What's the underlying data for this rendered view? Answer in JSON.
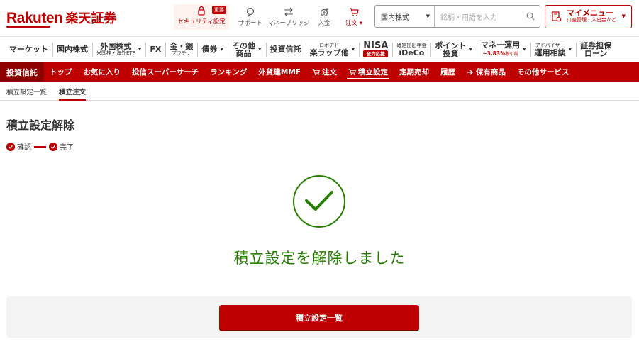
{
  "header": {
    "logo_en": "Rakuten",
    "logo_jp": "楽天証券",
    "icons": [
      {
        "icon": "lock-icon",
        "label": "セキュリティ設定",
        "badge": "重要"
      },
      {
        "icon": "support-chat-icon",
        "label": "サポート"
      },
      {
        "icon": "bank-transfer-icon",
        "label": "マネーブリッジ"
      },
      {
        "icon": "deposit-icon",
        "label": "入金"
      },
      {
        "icon": "cart-icon",
        "label": "注文 ▾"
      }
    ],
    "search": {
      "market": "国内株式",
      "placeholder": "銘柄・用語を入力"
    },
    "mymenu": {
      "title": "マイメニュー",
      "sub": "口座管理・入出金など"
    }
  },
  "category_nav": [
    {
      "label": "マーケット"
    },
    {
      "label": "国内株式"
    },
    {
      "label": "外国株式",
      "sub": "米国株・海外ETF",
      "dropdown": true
    },
    {
      "label": "FX"
    },
    {
      "label": "金・銀",
      "sub": "プラチナ"
    },
    {
      "label": "債券",
      "dropdown": true
    },
    {
      "label": "その他",
      "label2": "商品",
      "dropdown": true
    },
    {
      "label": "投資信託"
    },
    {
      "pre": "ロボアド",
      "label": "楽ラップ他",
      "dropdown": true
    },
    {
      "label": "NISA",
      "badge": "全力応援"
    },
    {
      "pre": "確定拠出年金",
      "label": "iDeCo"
    },
    {
      "label": "ポイント",
      "label2": "投資",
      "dropdown": true
    },
    {
      "label": "マネー運用",
      "red": "~3.83%",
      "red_small": "税引前",
      "dropdown": true
    },
    {
      "pre": "アドバイザー",
      "label": "運用相談",
      "dropdown": true
    },
    {
      "label": "証券担保",
      "label2": "ローン"
    }
  ],
  "fund_nav": {
    "brand": "投資信託",
    "items": [
      {
        "label": "トップ"
      },
      {
        "label": "お気に入り"
      },
      {
        "label": "投信スーパーサーチ"
      },
      {
        "label": "ランキング"
      },
      {
        "label": "外貨建MMF"
      },
      {
        "label": "注文",
        "icon": "cart-icon"
      },
      {
        "label": "積立設定",
        "icon": "cart-icon",
        "active": true
      },
      {
        "label": "定期売却"
      },
      {
        "label": "履歴"
      },
      {
        "label": "保有商品",
        "icon": "arrow-right-icon"
      },
      {
        "label": "その他サービス"
      }
    ]
  },
  "sub_nav": [
    {
      "label": "積立設定一覧"
    },
    {
      "label": "積立注文",
      "active": true
    }
  ],
  "main": {
    "title": "積立設定解除",
    "steps": [
      "確認",
      "完了"
    ],
    "completion_message": "積立設定を解除しました",
    "primary_button": "積立設定一覧"
  },
  "colors": {
    "brand_red": "#bf0000",
    "success_green": "#267f00"
  }
}
